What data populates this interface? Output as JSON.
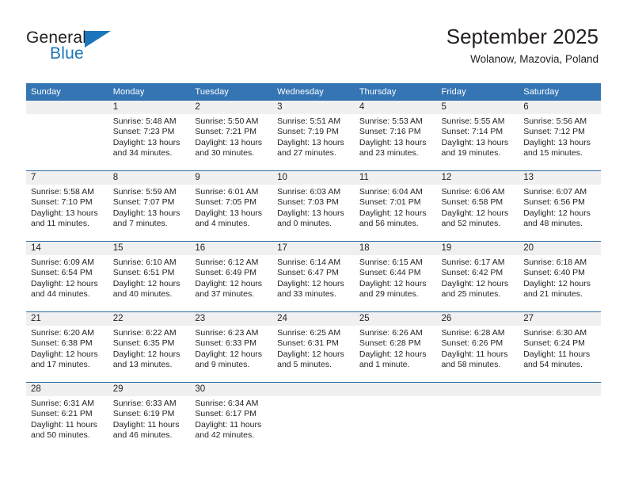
{
  "brand": {
    "name_part1": "General",
    "name_part2": "Blue",
    "flag_icon": "triangle-flag-icon"
  },
  "header": {
    "month_title": "September 2025",
    "location": "Wolanow, Mazovia, Poland"
  },
  "theme": {
    "header_blue": "#3575b4",
    "grid_line_blue": "#2d6ba8",
    "daynum_band_gray": "#f0f0f0",
    "brand_blue": "#1b75bb",
    "text_dark": "#231f20"
  },
  "weekday_headers": [
    "Sunday",
    "Monday",
    "Tuesday",
    "Wednesday",
    "Thursday",
    "Friday",
    "Saturday"
  ],
  "labels": {
    "sunrise": "Sunrise:",
    "sunset": "Sunset:",
    "daylight": "Daylight:"
  },
  "weeks": [
    [
      {
        "day": "",
        "sunrise": "",
        "sunset": "",
        "daylight_line1": "",
        "daylight_line2": ""
      },
      {
        "day": "1",
        "sunrise": "Sunrise: 5:48 AM",
        "sunset": "Sunset: 7:23 PM",
        "daylight_line1": "Daylight: 13 hours",
        "daylight_line2": "and 34 minutes."
      },
      {
        "day": "2",
        "sunrise": "Sunrise: 5:50 AM",
        "sunset": "Sunset: 7:21 PM",
        "daylight_line1": "Daylight: 13 hours",
        "daylight_line2": "and 30 minutes."
      },
      {
        "day": "3",
        "sunrise": "Sunrise: 5:51 AM",
        "sunset": "Sunset: 7:19 PM",
        "daylight_line1": "Daylight: 13 hours",
        "daylight_line2": "and 27 minutes."
      },
      {
        "day": "4",
        "sunrise": "Sunrise: 5:53 AM",
        "sunset": "Sunset: 7:16 PM",
        "daylight_line1": "Daylight: 13 hours",
        "daylight_line2": "and 23 minutes."
      },
      {
        "day": "5",
        "sunrise": "Sunrise: 5:55 AM",
        "sunset": "Sunset: 7:14 PM",
        "daylight_line1": "Daylight: 13 hours",
        "daylight_line2": "and 19 minutes."
      },
      {
        "day": "6",
        "sunrise": "Sunrise: 5:56 AM",
        "sunset": "Sunset: 7:12 PM",
        "daylight_line1": "Daylight: 13 hours",
        "daylight_line2": "and 15 minutes."
      }
    ],
    [
      {
        "day": "7",
        "sunrise": "Sunrise: 5:58 AM",
        "sunset": "Sunset: 7:10 PM",
        "daylight_line1": "Daylight: 13 hours",
        "daylight_line2": "and 11 minutes."
      },
      {
        "day": "8",
        "sunrise": "Sunrise: 5:59 AM",
        "sunset": "Sunset: 7:07 PM",
        "daylight_line1": "Daylight: 13 hours",
        "daylight_line2": "and 7 minutes."
      },
      {
        "day": "9",
        "sunrise": "Sunrise: 6:01 AM",
        "sunset": "Sunset: 7:05 PM",
        "daylight_line1": "Daylight: 13 hours",
        "daylight_line2": "and 4 minutes."
      },
      {
        "day": "10",
        "sunrise": "Sunrise: 6:03 AM",
        "sunset": "Sunset: 7:03 PM",
        "daylight_line1": "Daylight: 13 hours",
        "daylight_line2": "and 0 minutes."
      },
      {
        "day": "11",
        "sunrise": "Sunrise: 6:04 AM",
        "sunset": "Sunset: 7:01 PM",
        "daylight_line1": "Daylight: 12 hours",
        "daylight_line2": "and 56 minutes."
      },
      {
        "day": "12",
        "sunrise": "Sunrise: 6:06 AM",
        "sunset": "Sunset: 6:58 PM",
        "daylight_line1": "Daylight: 12 hours",
        "daylight_line2": "and 52 minutes."
      },
      {
        "day": "13",
        "sunrise": "Sunrise: 6:07 AM",
        "sunset": "Sunset: 6:56 PM",
        "daylight_line1": "Daylight: 12 hours",
        "daylight_line2": "and 48 minutes."
      }
    ],
    [
      {
        "day": "14",
        "sunrise": "Sunrise: 6:09 AM",
        "sunset": "Sunset: 6:54 PM",
        "daylight_line1": "Daylight: 12 hours",
        "daylight_line2": "and 44 minutes."
      },
      {
        "day": "15",
        "sunrise": "Sunrise: 6:10 AM",
        "sunset": "Sunset: 6:51 PM",
        "daylight_line1": "Daylight: 12 hours",
        "daylight_line2": "and 40 minutes."
      },
      {
        "day": "16",
        "sunrise": "Sunrise: 6:12 AM",
        "sunset": "Sunset: 6:49 PM",
        "daylight_line1": "Daylight: 12 hours",
        "daylight_line2": "and 37 minutes."
      },
      {
        "day": "17",
        "sunrise": "Sunrise: 6:14 AM",
        "sunset": "Sunset: 6:47 PM",
        "daylight_line1": "Daylight: 12 hours",
        "daylight_line2": "and 33 minutes."
      },
      {
        "day": "18",
        "sunrise": "Sunrise: 6:15 AM",
        "sunset": "Sunset: 6:44 PM",
        "daylight_line1": "Daylight: 12 hours",
        "daylight_line2": "and 29 minutes."
      },
      {
        "day": "19",
        "sunrise": "Sunrise: 6:17 AM",
        "sunset": "Sunset: 6:42 PM",
        "daylight_line1": "Daylight: 12 hours",
        "daylight_line2": "and 25 minutes."
      },
      {
        "day": "20",
        "sunrise": "Sunrise: 6:18 AM",
        "sunset": "Sunset: 6:40 PM",
        "daylight_line1": "Daylight: 12 hours",
        "daylight_line2": "and 21 minutes."
      }
    ],
    [
      {
        "day": "21",
        "sunrise": "Sunrise: 6:20 AM",
        "sunset": "Sunset: 6:38 PM",
        "daylight_line1": "Daylight: 12 hours",
        "daylight_line2": "and 17 minutes."
      },
      {
        "day": "22",
        "sunrise": "Sunrise: 6:22 AM",
        "sunset": "Sunset: 6:35 PM",
        "daylight_line1": "Daylight: 12 hours",
        "daylight_line2": "and 13 minutes."
      },
      {
        "day": "23",
        "sunrise": "Sunrise: 6:23 AM",
        "sunset": "Sunset: 6:33 PM",
        "daylight_line1": "Daylight: 12 hours",
        "daylight_line2": "and 9 minutes."
      },
      {
        "day": "24",
        "sunrise": "Sunrise: 6:25 AM",
        "sunset": "Sunset: 6:31 PM",
        "daylight_line1": "Daylight: 12 hours",
        "daylight_line2": "and 5 minutes."
      },
      {
        "day": "25",
        "sunrise": "Sunrise: 6:26 AM",
        "sunset": "Sunset: 6:28 PM",
        "daylight_line1": "Daylight: 12 hours",
        "daylight_line2": "and 1 minute."
      },
      {
        "day": "26",
        "sunrise": "Sunrise: 6:28 AM",
        "sunset": "Sunset: 6:26 PM",
        "daylight_line1": "Daylight: 11 hours",
        "daylight_line2": "and 58 minutes."
      },
      {
        "day": "27",
        "sunrise": "Sunrise: 6:30 AM",
        "sunset": "Sunset: 6:24 PM",
        "daylight_line1": "Daylight: 11 hours",
        "daylight_line2": "and 54 minutes."
      }
    ],
    [
      {
        "day": "28",
        "sunrise": "Sunrise: 6:31 AM",
        "sunset": "Sunset: 6:21 PM",
        "daylight_line1": "Daylight: 11 hours",
        "daylight_line2": "and 50 minutes."
      },
      {
        "day": "29",
        "sunrise": "Sunrise: 6:33 AM",
        "sunset": "Sunset: 6:19 PM",
        "daylight_line1": "Daylight: 11 hours",
        "daylight_line2": "and 46 minutes."
      },
      {
        "day": "30",
        "sunrise": "Sunrise: 6:34 AM",
        "sunset": "Sunset: 6:17 PM",
        "daylight_line1": "Daylight: 11 hours",
        "daylight_line2": "and 42 minutes."
      },
      {
        "day": "",
        "sunrise": "",
        "sunset": "",
        "daylight_line1": "",
        "daylight_line2": ""
      },
      {
        "day": "",
        "sunrise": "",
        "sunset": "",
        "daylight_line1": "",
        "daylight_line2": ""
      },
      {
        "day": "",
        "sunrise": "",
        "sunset": "",
        "daylight_line1": "",
        "daylight_line2": ""
      },
      {
        "day": "",
        "sunrise": "",
        "sunset": "",
        "daylight_line1": "",
        "daylight_line2": ""
      }
    ]
  ]
}
